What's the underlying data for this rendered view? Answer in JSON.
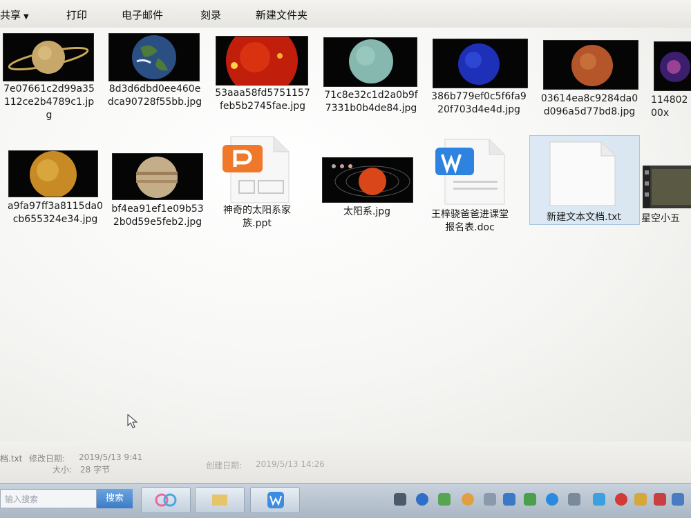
{
  "toolbar": {
    "share_label": "共享",
    "print_label": "打印",
    "email_label": "电子邮件",
    "burn_label": "刻录",
    "new_folder_label": "新建文件夹"
  },
  "files": [
    {
      "name": "7e07661c2d99a35112ce2b4789c1.jpg",
      "icon": "saturn-thumbnail"
    },
    {
      "name": "8d3d6dbd0ee460edca90728f55bb.jpg",
      "icon": "earth-thumbnail"
    },
    {
      "name": "53aaa58fd5751157feb5b2745fae.jpg",
      "icon": "sun-thumbnail"
    },
    {
      "name": "71c8e32c1d2a0b9f7331b0b4de84.jpg",
      "icon": "uranus-thumbnail"
    },
    {
      "name": "386b779ef0c5f6fa920f703d4e4d.jpg",
      "icon": "neptune-thumbnail"
    },
    {
      "name": "03614ea8c9284da0d096a5d77bd8.jpg",
      "icon": "mars-thumbnail"
    },
    {
      "name": "11480200x",
      "icon": "nebula-thumbnail"
    },
    {
      "name": "a9fa97ff3a8115da0cb655324e34.jpg",
      "icon": "venus-thumbnail"
    },
    {
      "name": "bf4ea91ef1e09b532b0d59e5feb2.jpg",
      "icon": "jupiter-thumbnail"
    },
    {
      "name": "神奇的太阳系家族.ppt",
      "icon": "ppt-file-icon"
    },
    {
      "name": "太阳系.jpg",
      "icon": "solar-system-thumbnail"
    },
    {
      "name": "王梓骁爸爸进课堂报名表.doc",
      "icon": "doc-file-icon"
    },
    {
      "name": "新建文本文档.txt",
      "icon": "txt-file-icon"
    },
    {
      "name": "星空小五",
      "icon": "video-file-icon"
    }
  ],
  "status": {
    "file_name": "档.txt",
    "modified_label": "修改日期:",
    "modified_value": "2019/5/13 9:41",
    "size_label": "大小:",
    "size_value": "28 字节",
    "created_label": "创建日期:",
    "created_value": "2019/5/13 14:26"
  },
  "taskbar": {
    "search_placeholder": "输入搜索",
    "search_button": "搜索"
  },
  "colors": {
    "selection": "#a9c6e6",
    "ppt_orange": "#f0782a",
    "wps_blue": "#2f83e0"
  }
}
